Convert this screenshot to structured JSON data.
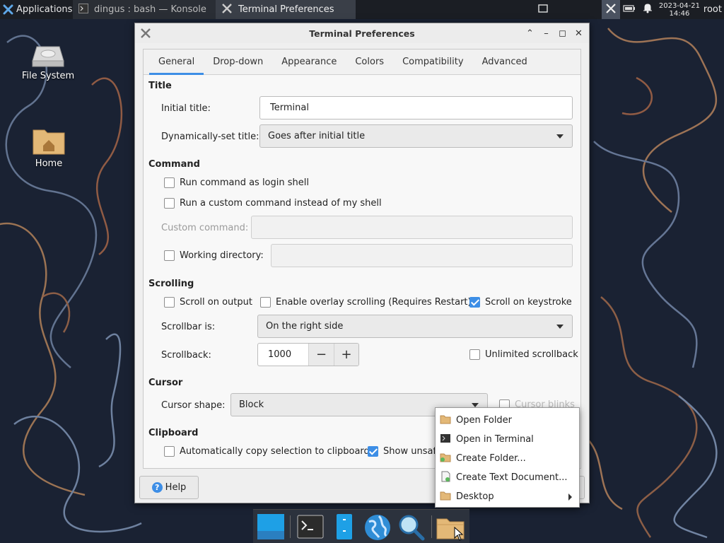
{
  "panel": {
    "apps_label": "Applications",
    "tasks": [
      {
        "label": "dingus : bash — Konsole"
      },
      {
        "label": "Terminal Preferences"
      }
    ],
    "clock_date": "2023-04-21",
    "clock_time": "14:46",
    "user": "root"
  },
  "desktop": {
    "icons": [
      {
        "label": "File System"
      },
      {
        "label": "Home"
      }
    ]
  },
  "window": {
    "title": "Terminal Preferences",
    "tabs": [
      "General",
      "Drop-down",
      "Appearance",
      "Colors",
      "Compatibility",
      "Advanced"
    ],
    "active_tab": "General",
    "sections": {
      "title": "Title",
      "command": "Command",
      "scrolling": "Scrolling",
      "cursor": "Cursor",
      "clipboard": "Clipboard"
    },
    "title_section": {
      "initial_title_label": "Initial title:",
      "initial_title_value": "Terminal",
      "dynamic_title_label": "Dynamically-set title:",
      "dynamic_title_value": "Goes after initial title"
    },
    "command_section": {
      "login_shell": {
        "label": "Run command as login shell",
        "checked": false
      },
      "custom_cmd": {
        "label": "Run a custom command instead of my shell",
        "checked": false
      },
      "custom_cmd_label": "Custom command:",
      "custom_cmd_value": "",
      "working_dir": {
        "label": "Working directory:",
        "checked": false
      },
      "working_dir_value": ""
    },
    "scrolling_section": {
      "scroll_output": {
        "label": "Scroll on output",
        "checked": false
      },
      "overlay": {
        "label": "Enable overlay scrolling (Requires Restart)",
        "checked": false
      },
      "scroll_keystroke": {
        "label": "Scroll on keystroke",
        "checked": true
      },
      "scrollbar_label": "Scrollbar is:",
      "scrollbar_value": "On the right side",
      "scrollback_label": "Scrollback:",
      "scrollback_value": "1000",
      "unlimited": {
        "label": "Unlimited scrollback",
        "checked": false
      }
    },
    "cursor_section": {
      "shape_label": "Cursor shape:",
      "shape_value": "Block",
      "blinks": {
        "label": "Cursor blinks",
        "checked": false
      }
    },
    "clipboard_section": {
      "auto_copy": {
        "label": "Automatically copy selection to clipboard",
        "checked": false
      },
      "show_unsafe": {
        "label": "Show unsafe",
        "checked": true
      }
    },
    "help_label": "Help"
  },
  "context_menu": {
    "items": [
      {
        "label": "Open Folder"
      },
      {
        "label": "Open in Terminal"
      },
      {
        "label": "Create Folder..."
      },
      {
        "label": "Create Text Document..."
      },
      {
        "label": "Desktop"
      }
    ]
  },
  "colors": {
    "accent": "#3d8ee6",
    "panel_bg": "#1b1e24",
    "window_bg": "#efefef"
  }
}
